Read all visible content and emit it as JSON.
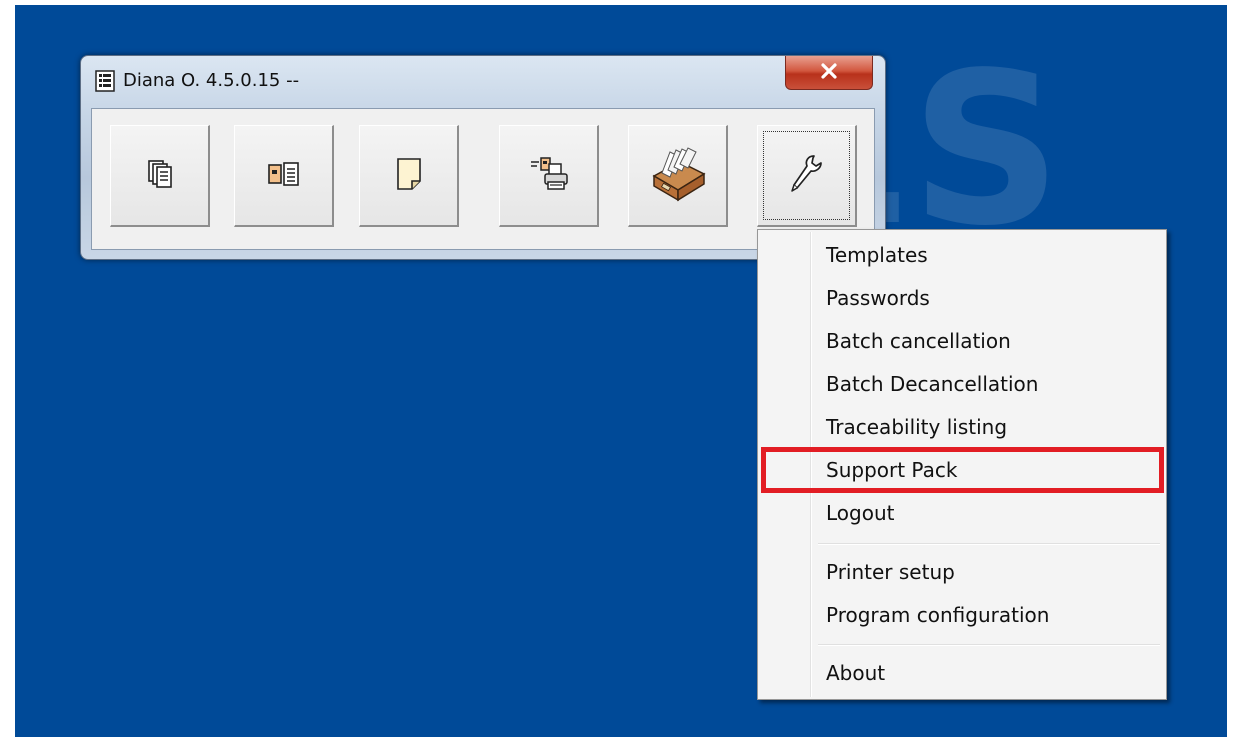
{
  "window": {
    "title": "Diana O. 4.5.0.15 --",
    "app_icon": "document-list-icon",
    "close_icon": "close-x-icon"
  },
  "toolbar": {
    "buttons": [
      {
        "icon": "documents-stack-icon"
      },
      {
        "icon": "transfer-documents-icon"
      },
      {
        "icon": "blank-document-icon"
      },
      {
        "icon": "print-documents-icon"
      },
      {
        "icon": "card-file-box-icon"
      },
      {
        "icon": "wrench-icon",
        "focused": true
      }
    ]
  },
  "menu": {
    "items": [
      {
        "label": "Templates"
      },
      {
        "label": "Passwords"
      },
      {
        "label": "Batch cancellation"
      },
      {
        "label": "Batch Decancellation"
      },
      {
        "label": "Traceability listing"
      },
      {
        "label": "Support Pack",
        "highlighted": true
      },
      {
        "label": "Logout"
      },
      {
        "label": "Printer setup"
      },
      {
        "label": "Program configuration"
      },
      {
        "label": "About"
      }
    ]
  },
  "colors": {
    "desktop": "#004a98",
    "highlight_box": "#e21d24",
    "close_button": "#c9432c"
  }
}
